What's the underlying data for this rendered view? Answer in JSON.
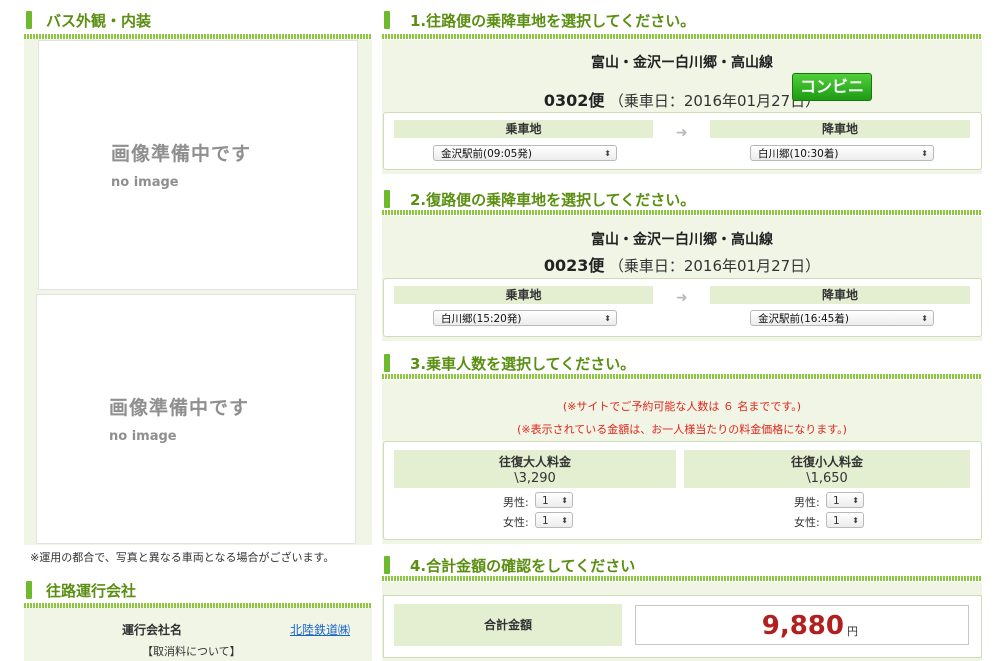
{
  "left": {
    "bus_section_title": "バス外観・内装",
    "no_image_main": "画像準備中です",
    "no_image_sub": "no image",
    "photo_note": "※運用の都合で、写真と異なる車両となる場合がございます。",
    "operator_section_title": "往路運行会社",
    "operator_label": "運行会社名",
    "operator_name": "北陸鉄道㈱",
    "cancel_label": "【取消料について】"
  },
  "outbound": {
    "section_title": "1.往路便の乗降車地を選択してください。",
    "route": "富山・金沢ー白川郷・高山線",
    "bin_number": "0302便",
    "bin_date": "（乗車日：2016年01月27日）",
    "badge": "コンビニ",
    "board_label": "乗車地",
    "alight_label": "降車地",
    "board_value": "金沢駅前(09:05発)",
    "alight_value": "白川郷(10:30着)"
  },
  "return": {
    "section_title": "2.復路便の乗降車地を選択してください。",
    "route": "富山・金沢ー白川郷・高山線",
    "bin_number": "0023便",
    "bin_date": "（乗車日：2016年01月27日）",
    "board_label": "乗車地",
    "alight_label": "降車地",
    "board_value": "白川郷(15:20発)",
    "alight_value": "金沢駅前(16:45着)"
  },
  "passengers": {
    "section_title": "3.乗車人数を選択してください。",
    "note_1": "(※サイトでご予約可能な人数は ６ 名までです。)",
    "note_2": "(※表示されている金額は、お一人様当たりの料金価格になります。)",
    "adult_label": "往復大人料金",
    "adult_price": "\\3,290",
    "child_label": "往復小人料金",
    "child_price": "\\1,650",
    "male_label": "男性:",
    "female_label": "女性:",
    "adult_male": "1",
    "adult_female": "1",
    "child_male": "1",
    "child_female": "1"
  },
  "total": {
    "section_title": "4.合計金額の確認をしてください",
    "label": "合計金額",
    "amount": "9,880",
    "unit": "円"
  },
  "icons": {
    "arrow": "right-arrow-icon",
    "select": "select-caret-icon"
  },
  "colors": {
    "accent_green": "#6fba2c",
    "heading_green": "#5a8f12",
    "panel_bg": "#f0f5e6",
    "price_red": "#b1201f",
    "notice_red": "#e0261b",
    "link_blue": "#1a64c8"
  }
}
